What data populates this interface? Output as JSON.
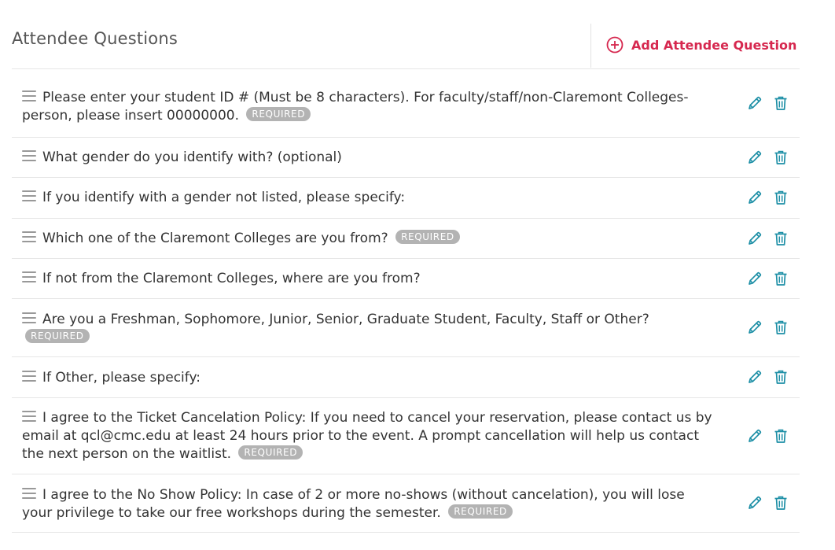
{
  "header": {
    "title": "Attendee Questions",
    "add_label": "Add Attendee Question"
  },
  "required_label": "REQUIRED",
  "colors": {
    "accent": "#d6284f",
    "action_icon": "#1d8fa6",
    "badge": "#b3b3b3"
  },
  "questions": [
    {
      "text": "Please enter your student ID # (Must be 8 characters). For faculty/staff/non-Claremont Colleges-person, please insert 00000000.",
      "required": true
    },
    {
      "text": "What gender do you identify with? (optional)",
      "required": false
    },
    {
      "text": "If you identify with a gender not listed, please specify:",
      "required": false
    },
    {
      "text": "Which one of the Claremont Colleges are you from?",
      "required": true
    },
    {
      "text": "If not from the Claremont Colleges, where are you from?",
      "required": false
    },
    {
      "text": "Are you a Freshman, Sophomore, Junior, Senior, Graduate Student, Faculty, Staff or Other?",
      "required": true
    },
    {
      "text": "If Other, please specify:",
      "required": false
    },
    {
      "text": "I agree to the Ticket Cancelation Policy: If you need to cancel your reservation, please contact us by email at qcl@cmc.edu at least 24 hours prior to the event. A prompt cancellation will help us contact the next person on the waitlist.",
      "required": true
    },
    {
      "text": "I agree to the No Show Policy: In case of 2 or more no-shows (without cancelation), you will lose your privilege to take our free workshops during the semester.",
      "required": true
    }
  ]
}
